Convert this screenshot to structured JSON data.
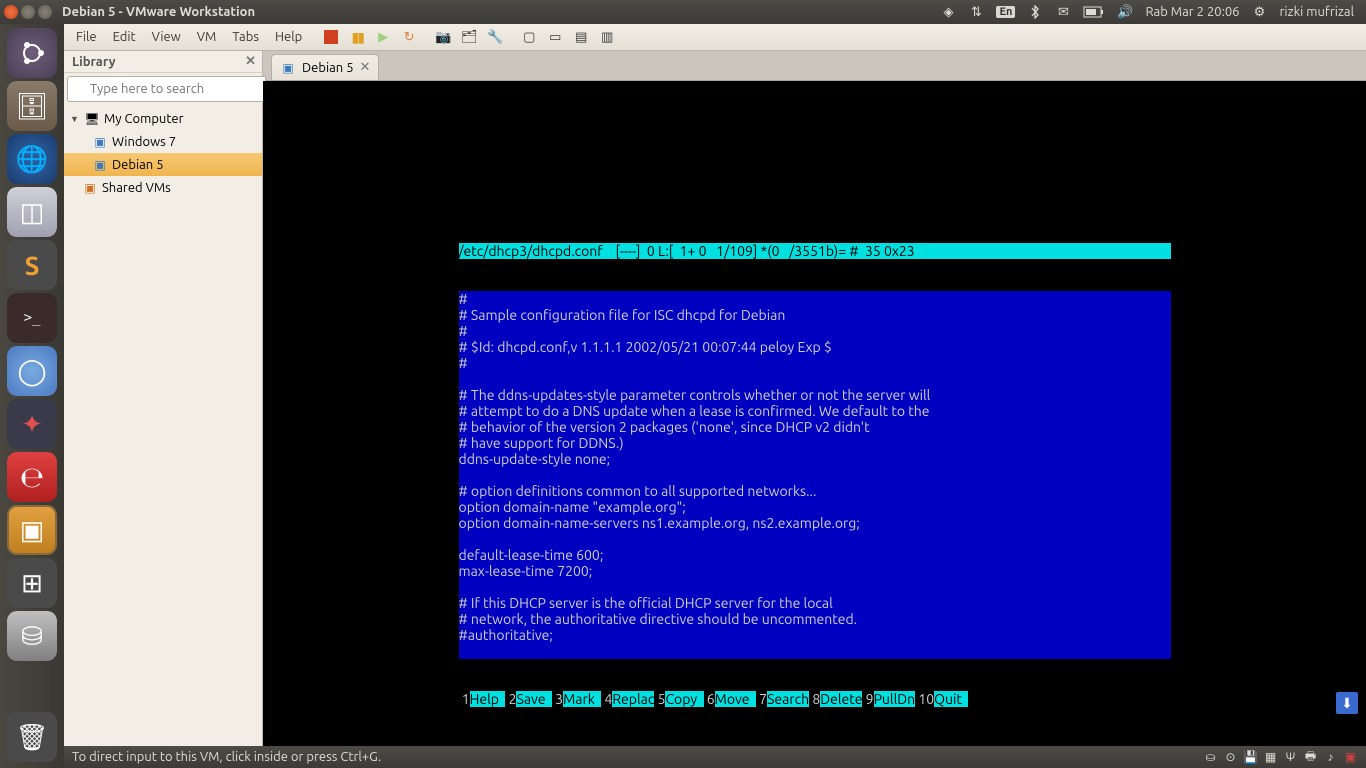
{
  "unity": {
    "title": "Debian 5 - VMware Workstation",
    "lang": "En",
    "date": "Rab Mar  2 20:06",
    "user": "rizki mufrizal"
  },
  "menu": {
    "items": [
      "File",
      "Edit",
      "View",
      "VM",
      "Tabs",
      "Help"
    ]
  },
  "sidebar": {
    "title": "Library",
    "search_placeholder": "Type here to search",
    "root": "My Computer",
    "items": [
      "Windows 7",
      "Debian 5"
    ],
    "shared": "Shared VMs"
  },
  "tab": {
    "label": "Debian 5"
  },
  "terminal": {
    "status": "/etc/dhcp3/dhcpd.conf    [----]  0 L:[  1+ 0   1/109] *(0   /3551b)= #  35 0x23",
    "lines": [
      "#",
      "# Sample configuration file for ISC dhcpd for Debian",
      "#",
      "# $Id: dhcpd.conf,v 1.1.1.1 2002/05/21 00:07:44 peloy Exp $",
      "#",
      "",
      "# The ddns-updates-style parameter controls whether or not the server will",
      "# attempt to do a DNS update when a lease is confirmed. We default to the",
      "# behavior of the version 2 packages ('none', since DHCP v2 didn't",
      "# have support for DDNS.)",
      "ddns-update-style none;",
      "",
      "# option definitions common to all supported networks...",
      "option domain-name \"example.org\";",
      "option domain-name-servers ns1.example.org, ns2.example.org;",
      "",
      "default-lease-time 600;",
      "max-lease-time 7200;",
      "",
      "# If this DHCP server is the official DHCP server for the local",
      "# network, the authoritative directive should be uncommented.",
      "#authoritative;",
      ""
    ],
    "fkeys": [
      {
        "n": "1",
        "l": "Help  "
      },
      {
        "n": "2",
        "l": "Save  "
      },
      {
        "n": "3",
        "l": "Mark  "
      },
      {
        "n": "4",
        "l": "Replac"
      },
      {
        "n": "5",
        "l": "Copy  "
      },
      {
        "n": "6",
        "l": "Move  "
      },
      {
        "n": "7",
        "l": "Search"
      },
      {
        "n": "8",
        "l": "Delete"
      },
      {
        "n": "9",
        "l": "PullDn"
      },
      {
        "n": "10",
        "l": "Quit  "
      }
    ]
  },
  "statusbar": {
    "text": "To direct input to this VM, click inside or press Ctrl+G."
  }
}
